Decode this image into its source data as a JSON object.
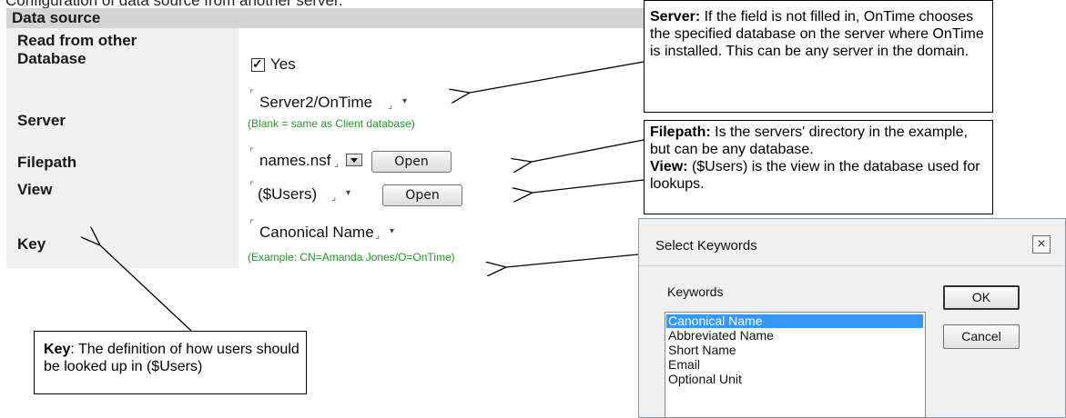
{
  "caption": "Configuration of data source from another server.",
  "form": {
    "header": "Data source",
    "rows": {
      "read": {
        "label_line1": "Read from other",
        "label_line2": "Database",
        "checkbox_label": "Yes"
      },
      "server": {
        "label": "Server",
        "value": "Server2/OnTime",
        "hint": "(Blank = same as Client database)"
      },
      "filepath": {
        "label": "Filepath",
        "value": "names.nsf",
        "button": "Open"
      },
      "view": {
        "label": "View",
        "value": "($Users)",
        "button": "Open"
      },
      "key": {
        "label": "Key",
        "value": "Canonical Name",
        "hint": "(Example: CN=Amanda Jones/O=OnTime)"
      }
    },
    "glyphs": {
      "bracket_open": "⌜",
      "bracket_close": "⌟",
      "dropdown": "▾"
    }
  },
  "callouts": {
    "server": {
      "title": "Server:",
      "text": " If the field is not filled in, OnTime chooses the specified database on the server where OnTime is installed. This can be any server in the domain."
    },
    "filepath": {
      "title": "Filepath:",
      "text": " Is the servers' directory in the example, but can be any database.",
      "view_title": "View:",
      "view_text": " ($Users) is the view in the database used for lookups."
    },
    "key": {
      "title": "Key",
      "text": ": The definition of how users should be looked up in ($Users)"
    }
  },
  "dialog": {
    "title": "Select Keywords",
    "close": "×",
    "list_label": "Keywords",
    "items": [
      "Canonical Name",
      "Abbreviated Name",
      "Short Name",
      "Email",
      "Optional Unit"
    ],
    "selected_index": 0,
    "ok": "OK",
    "cancel": "Cancel"
  },
  "colors": {
    "hint_green": "#1e9a1e",
    "selection_blue": "#3399ff",
    "header_gray": "#d4d4d4",
    "panel_gray": "#f0f0f0"
  }
}
